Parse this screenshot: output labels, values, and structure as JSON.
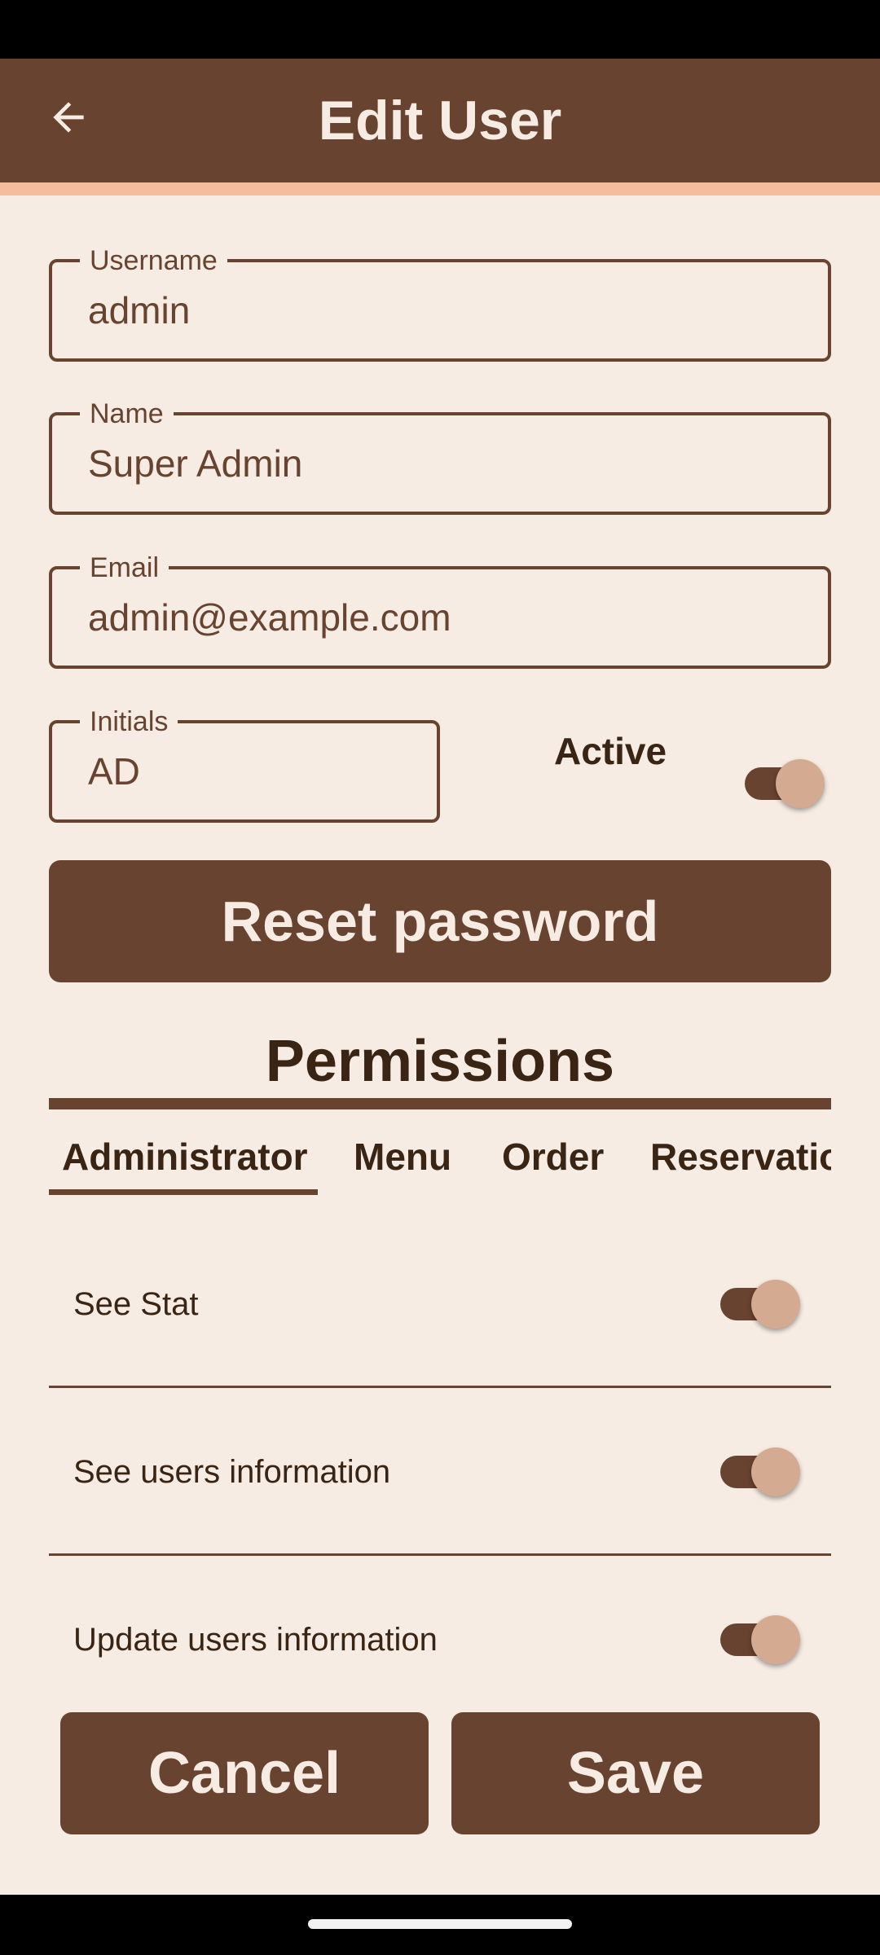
{
  "app_bar": {
    "title": "Edit User",
    "back_icon": "arrow-back-icon"
  },
  "form": {
    "username": {
      "label": "Username",
      "value": "admin"
    },
    "name": {
      "label": "Name",
      "value": "Super Admin"
    },
    "email": {
      "label": "Email",
      "value": "admin@example.com"
    },
    "initials": {
      "label": "Initials",
      "value": "AD"
    },
    "active": {
      "label": "Active",
      "on": true
    }
  },
  "reset_password_label": "Reset password",
  "permissions": {
    "title": "Permissions",
    "tabs": [
      {
        "label": "Administrator",
        "selected": true
      },
      {
        "label": "Menu",
        "selected": false
      },
      {
        "label": "Order",
        "selected": false
      },
      {
        "label": "Reservatio",
        "selected": false
      }
    ],
    "items": [
      {
        "label": "See Stat",
        "on": true
      },
      {
        "label": "See users information",
        "on": true
      },
      {
        "label": "Update users information",
        "on": true
      }
    ]
  },
  "actions": {
    "cancel_label": "Cancel",
    "save_label": "Save"
  },
  "colors": {
    "primary": "#68432F",
    "background": "#F6ECE4",
    "accent": "#F5BD9B",
    "thumb": "#D4AA91"
  }
}
